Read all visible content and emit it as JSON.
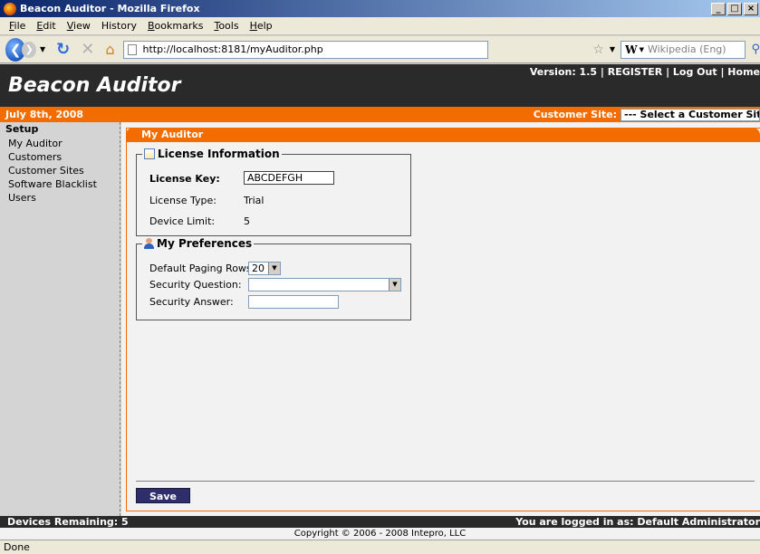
{
  "window": {
    "title": "Beacon Auditor - Mozilla Firefox",
    "buttons": [
      "_",
      "□",
      "×"
    ]
  },
  "menu": {
    "items": [
      {
        "key": "F",
        "rest": "ile"
      },
      {
        "key": "E",
        "rest": "dit"
      },
      {
        "key": "V",
        "rest": "iew"
      },
      {
        "key": "",
        "rest": "History"
      },
      {
        "key": "B",
        "rest": "ookmarks"
      },
      {
        "key": "T",
        "rest": "ools"
      },
      {
        "key": "H",
        "rest": "elp"
      }
    ]
  },
  "nav": {
    "url": "http://localhost:8181/myAuditor.php",
    "search_placeholder": "Wikipedia (Eng)",
    "search_engine": "W"
  },
  "header": {
    "app_title": "Beacon Auditor",
    "links": "Version: 1.5 | REGISTER | Log Out | Home"
  },
  "datebar": {
    "date": "July 8th, 2008",
    "customer_site_label": "Customer Site:",
    "customer_site_value": "--- Select a Customer Site ---"
  },
  "sidebar": {
    "heading": "Setup",
    "items": [
      "My Auditor",
      "Customers",
      "Customer Sites",
      "Software Blacklist",
      "Users"
    ]
  },
  "panel": {
    "title": "My Auditor",
    "license": {
      "legend": "License Information",
      "key_label": "License Key:",
      "key_value": "ABCDEFGH",
      "type_label": "License Type:",
      "type_value": "Trial",
      "limit_label": "Device Limit:",
      "limit_value": "5"
    },
    "prefs": {
      "legend": "My Preferences",
      "paging_label": "Default Paging Rows:",
      "paging_value": "20",
      "question_label": "Security Question:",
      "question_value": "",
      "answer_label": "Security Answer:",
      "answer_value": ""
    },
    "save_label": "Save"
  },
  "footer": {
    "devices": "Devices Remaining: 5",
    "logged_in": "You are logged in as: Default Administrator",
    "copyright": "Copyright © 2006 - 2008 Intepro, LLC"
  },
  "status": "Done",
  "colors": {
    "orange": "#f26c00",
    "dark": "#2a2a2a",
    "save_button": "#2e2e6a"
  }
}
